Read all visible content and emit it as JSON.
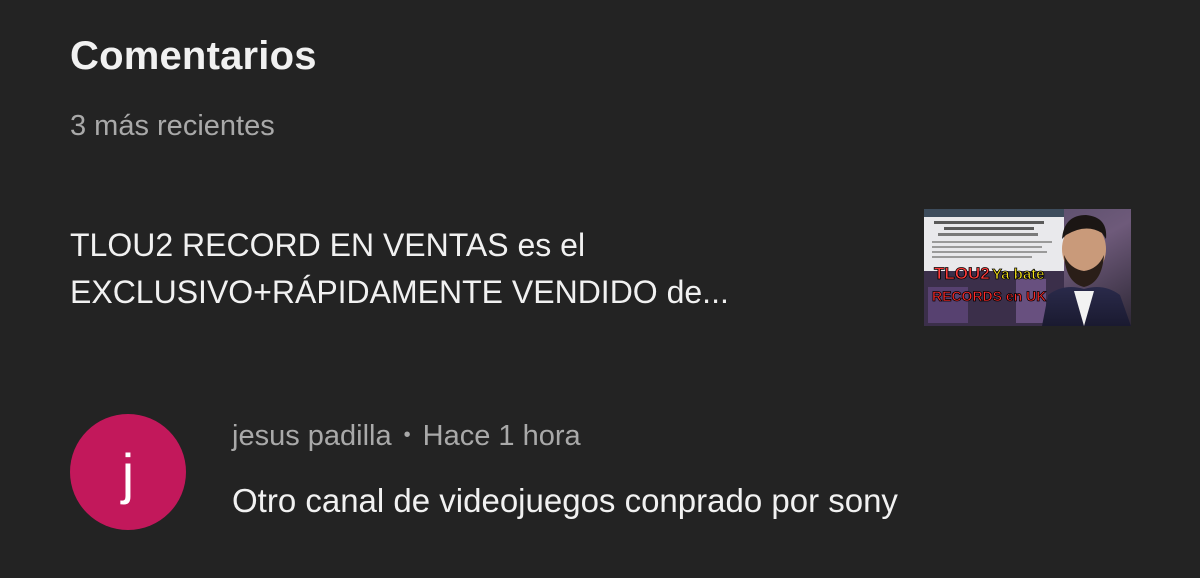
{
  "header": {
    "title": "Comentarios",
    "subtitle": "3 más recientes"
  },
  "video": {
    "title_line1": "TLOU2 RECORD EN VENTAS es el",
    "title_line2": "EXCLUSIVO+RÁPIDAMENTE VENDIDO de...",
    "thumbnail": {
      "overlay_text_1": "TLOU2",
      "overlay_text_2": "Ya bate",
      "overlay_text_3": "RECORDS en UK",
      "colors": {
        "tlou2": "#ff3b3b",
        "yabate": "#f5e11a",
        "records": "#ff2a2a"
      }
    }
  },
  "comment": {
    "avatar_letter": "j",
    "avatar_color": "#c2185b",
    "author": "jesus padilla",
    "separator": "•",
    "time": "Hace 1 hora",
    "text": "Otro canal de videojuegos conprado por sony"
  }
}
